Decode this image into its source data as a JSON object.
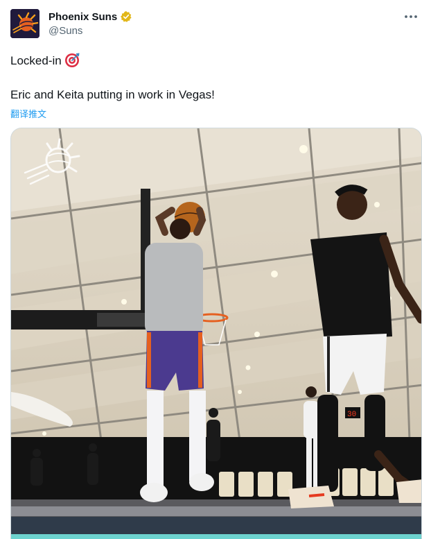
{
  "author": {
    "display_name": "Phoenix Suns",
    "handle": "@Suns",
    "verified_icon": "verified-badge-icon",
    "avatar_icon": "suns-logo-avatar"
  },
  "tweet": {
    "line1": "Locked-in",
    "line1_emoji": "direct-hit-target-emoji",
    "line2": "Eric and Keita putting in work in Vegas!",
    "translate_label": "翻译推文"
  },
  "media": {
    "scoreboard": "30",
    "watermark_icon": "suns-logo-watermark"
  },
  "colors": {
    "link": "#1d9bf0",
    "secondary_text": "#536471",
    "suns_purple": "#1d1160",
    "suns_orange": "#e56020",
    "verified_gold": "#e2b719"
  }
}
